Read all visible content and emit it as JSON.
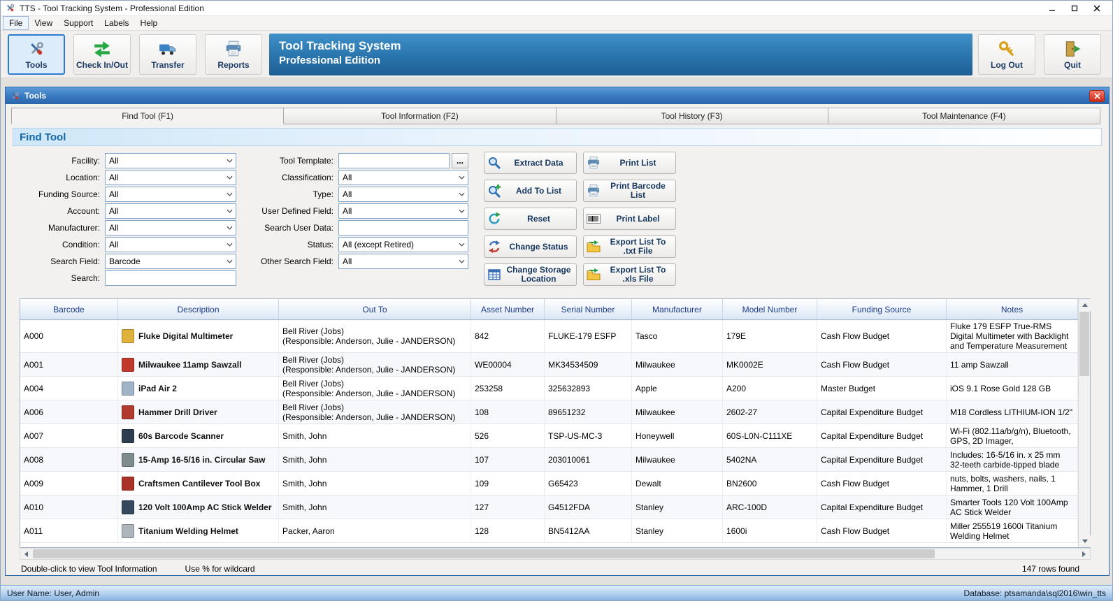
{
  "colors": {
    "banner_blue_top": "#3f90c8",
    "banner_blue_bottom": "#1d6094",
    "section_header_text": "#1367a8",
    "grid_header_text": "#1b3c8c",
    "active_toolbar_border": "#2f7ad1"
  },
  "window": {
    "title": "TTS - Tool Tracking System - Professional Edition",
    "app_icon": "tools-icon",
    "controls": [
      {
        "name": "minimize-button",
        "icon": "minimize-icon"
      },
      {
        "name": "maximize-button",
        "icon": "maximize-icon"
      },
      {
        "name": "close-button",
        "icon": "close-icon"
      }
    ]
  },
  "menu": [
    "File",
    "View",
    "Support",
    "Labels",
    "Help"
  ],
  "toolbar": {
    "buttons": [
      {
        "label": "Tools",
        "icon": "tools-icon",
        "active": true
      },
      {
        "label": "Check In/Out",
        "icon": "check-in-out-icon",
        "active": false
      },
      {
        "label": "Transfer",
        "icon": "transfer-truck-icon",
        "active": false
      },
      {
        "label": "Reports",
        "icon": "printer-icon",
        "active": false
      }
    ],
    "banner": {
      "title": "Tool Tracking System",
      "subtitle": "Professional Edition"
    },
    "right_buttons": [
      {
        "label": "Log Out",
        "icon": "key-icon"
      },
      {
        "label": "Quit",
        "icon": "exit-door-icon"
      }
    ]
  },
  "tools_window": {
    "title": "Tools",
    "icon": "tools-icon",
    "close_icon": "close-white-icon",
    "tabs": [
      {
        "label": "Find Tool (F1)",
        "active": true
      },
      {
        "label": "Tool Information (F2)",
        "active": false
      },
      {
        "label": "Tool History (F3)",
        "active": false
      },
      {
        "label": "Tool Maintenance (F4)",
        "active": false
      }
    ],
    "section_title": "Find Tool"
  },
  "form": {
    "left_fields": [
      {
        "label": "Facility:",
        "type": "combo",
        "value": "All"
      },
      {
        "label": "Location:",
        "type": "combo",
        "value": "All"
      },
      {
        "label": "Funding Source:",
        "type": "combo",
        "value": "All"
      },
      {
        "label": "Account:",
        "type": "combo",
        "value": "All"
      },
      {
        "label": "Manufacturer:",
        "type": "combo",
        "value": "All"
      },
      {
        "label": "Condition:",
        "type": "combo",
        "value": "All"
      },
      {
        "label": "Search Field:",
        "type": "combo",
        "value": "Barcode"
      },
      {
        "label": "Search:",
        "type": "input",
        "value": ""
      }
    ],
    "middle_fields": [
      {
        "label": "Tool Template:",
        "type": "input-browse",
        "value": "",
        "browse_label": "..."
      },
      {
        "label": "Classification:",
        "type": "combo",
        "value": "All"
      },
      {
        "label": "Type:",
        "type": "combo",
        "value": "All"
      },
      {
        "label": "User Defined Field:",
        "type": "combo",
        "value": "All"
      },
      {
        "label": "Search User Data:",
        "type": "input",
        "value": ""
      },
      {
        "label": "Status:",
        "type": "combo",
        "value": "All  (except Retired)"
      },
      {
        "label": "Other Search Field:",
        "type": "combo",
        "value": "All"
      }
    ]
  },
  "actions": {
    "column1": [
      {
        "label": "Extract Data",
        "icon": "search-icon"
      },
      {
        "label": "Add To List",
        "icon": "search-plus-icon"
      },
      {
        "label": "Reset",
        "icon": "refresh-icon"
      },
      {
        "label": "Change Status",
        "icon": "change-status-icon"
      },
      {
        "label": "Change Storage Location",
        "icon": "storage-grid-icon"
      }
    ],
    "column2": [
      {
        "label": "Print List",
        "icon": "printer-icon"
      },
      {
        "label": "Print Barcode List",
        "icon": "printer-icon"
      },
      {
        "label": "Print Label",
        "icon": "barcode-icon"
      },
      {
        "label": "Export List To .txt File",
        "icon": "export-folder-icon"
      },
      {
        "label": "Export List To .xls File",
        "icon": "export-folder-icon"
      }
    ]
  },
  "grid": {
    "columns": [
      "Barcode",
      "Description",
      "Out To",
      "Asset Number",
      "Serial Number",
      "Manufacturer",
      "Model Number",
      "Funding Source",
      "Notes"
    ],
    "rows": [
      {
        "barcode": "A000",
        "thumb": "#e0b23c",
        "description": "Fluke Digital Multimeter",
        "out_to": "Bell River (Jobs)\n(Responsible: Anderson, Julie - JANDERSON)",
        "asset": "842",
        "serial": "FLUKE-179 ESFP",
        "manufacturer": "Tasco",
        "model": "179E",
        "funding": "Cash Flow Budget",
        "notes": "Fluke 179 ESFP True-RMS Digital Multimeter with Backlight and Temperature Measurement"
      },
      {
        "barcode": "A001",
        "thumb": "#c0392b",
        "description": "Milwaukee 11amp Sawzall",
        "out_to": "Bell River (Jobs)\n(Responsible: Anderson, Julie - JANDERSON)",
        "asset": "WE00004",
        "serial": "MK34534509",
        "manufacturer": "Milwaukee",
        "model": "MK0002E",
        "funding": "Cash Flow Budget",
        "notes": "11 amp Sawzall"
      },
      {
        "barcode": "A004",
        "thumb": "#9fb3c8",
        "description": "iPad Air 2",
        "out_to": "Bell River (Jobs)\n(Responsible: Anderson, Julie - JANDERSON)",
        "asset": "253258",
        "serial": "325632893",
        "manufacturer": "Apple",
        "model": "A200",
        "funding": "Master Budget",
        "notes": "iOS 9.1 Rose Gold 128 GB"
      },
      {
        "barcode": "A006",
        "thumb": "#b03a2e",
        "description": "Hammer Drill Driver",
        "out_to": "Bell River (Jobs)\n(Responsible: Anderson, Julie - JANDERSON)",
        "asset": "108",
        "serial": "89651232",
        "manufacturer": "Milwaukee",
        "model": "2602-27",
        "funding": "Capital Expenditure Budget",
        "notes": "M18 Cordless LITHIUM-ION 1/2\""
      },
      {
        "barcode": "A007",
        "thumb": "#2c3e50",
        "description": "60s Barcode Scanner",
        "out_to": "Smith, John",
        "asset": "526",
        "serial": "TSP-US-MC-3",
        "manufacturer": "Honeywell",
        "model": "60S-L0N-C111XE",
        "funding": "Capital Expenditure Budget",
        "notes": "Wi-Fi (802.11a/b/g/n), Bluetooth, GPS, 2D Imager,"
      },
      {
        "barcode": "A008",
        "thumb": "#7f8c8d",
        "description": "15-Amp 16-5/16 in. Circular Saw",
        "out_to": "Smith, John",
        "asset": "107",
        "serial": "203010061",
        "manufacturer": "Milwaukee",
        "model": "5402NA",
        "funding": "Capital Expenditure Budget",
        "notes": "Includes: 16-5/16 in. x 25 mm 32-teeth carbide-tipped blade"
      },
      {
        "barcode": "A009",
        "thumb": "#a93226",
        "description": "Craftsmen Cantilever Tool Box",
        "out_to": "Smith, John",
        "asset": "109",
        "serial": "G65423",
        "manufacturer": "Dewalt",
        "model": "BN2600",
        "funding": "Cash Flow Budget",
        "notes": "nuts, bolts, washers, nails, 1 Hammer, 1 Drill"
      },
      {
        "barcode": "A010",
        "thumb": "#34495e",
        "description": "120 Volt 100Amp AC Stick Welder",
        "out_to": "Smith, John",
        "asset": "127",
        "serial": "G4512FDA",
        "manufacturer": "Stanley",
        "model": "ARC-100D",
        "funding": "Capital Expenditure Budget",
        "notes": "Smarter Tools 120 Volt 100Amp AC Stick Welder"
      },
      {
        "barcode": "A011",
        "thumb": "#aeb6bd",
        "description": "Titanium Welding Helmet",
        "out_to": "Packer, Aaron",
        "asset": "128",
        "serial": "BN5412AA",
        "manufacturer": "Stanley",
        "model": "1600i",
        "funding": "Cash Flow Budget",
        "notes": "Miller 255519 1600i Titanium Welding Helmet"
      }
    ],
    "footer": {
      "hint_primary": "Double-click to view Tool Information",
      "hint_secondary": "Use % for wildcard",
      "row_count": "147 rows found"
    }
  },
  "status_bar": {
    "user": "User Name:  User, Admin",
    "database": "Database:  ptsamanda\\sql2016\\win_tts"
  }
}
